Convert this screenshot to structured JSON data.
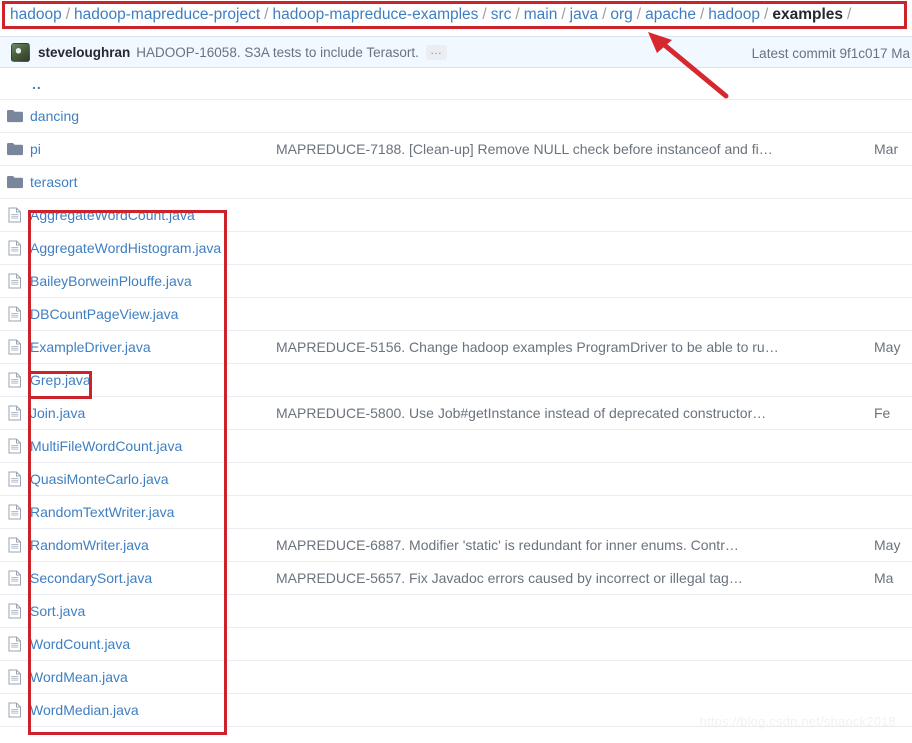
{
  "breadcrumb": {
    "separator": "/",
    "parts": [
      {
        "label": "hadoop",
        "current": false
      },
      {
        "label": "hadoop-mapreduce-project",
        "current": false
      },
      {
        "label": "hadoop-mapreduce-examples",
        "current": false
      },
      {
        "label": "src",
        "current": false
      },
      {
        "label": "main",
        "current": false
      },
      {
        "label": "java",
        "current": false
      },
      {
        "label": "org",
        "current": false
      },
      {
        "label": "apache",
        "current": false
      },
      {
        "label": "hadoop",
        "current": false
      },
      {
        "label": "examples",
        "current": true
      }
    ],
    "trailing_separator": "/"
  },
  "commit_bar": {
    "avatar_name": "user-avatar",
    "author": "steveloughran",
    "message": "HADOOP-16058. S3A tests to include Terasort.",
    "expand_label": "…",
    "latest_commit": "Latest commit 9f1c017 Ma"
  },
  "file_table": {
    "parent_dir_label": "..",
    "rows": [
      {
        "type": "folder",
        "name": "dancing",
        "message": "",
        "age": ""
      },
      {
        "type": "folder",
        "name": "pi",
        "message": "MAPREDUCE-7188. [Clean-up] Remove NULL check before instanceof and fi…",
        "age": "Mar"
      },
      {
        "type": "folder",
        "name": "terasort",
        "message": "",
        "age": ""
      },
      {
        "type": "file",
        "name": "AggregateWordCount.java",
        "message": "",
        "age": ""
      },
      {
        "type": "file",
        "name": "AggregateWordHistogram.java",
        "message": "",
        "age": ""
      },
      {
        "type": "file",
        "name": "BaileyBorweinPlouffe.java",
        "message": "",
        "age": ""
      },
      {
        "type": "file",
        "name": "DBCountPageView.java",
        "message": "",
        "age": ""
      },
      {
        "type": "file",
        "name": "ExampleDriver.java",
        "message": "MAPREDUCE-5156. Change hadoop examples ProgramDriver to be able to ru…",
        "age": "May"
      },
      {
        "type": "file",
        "name": "Grep.java",
        "message": "",
        "age": ""
      },
      {
        "type": "file",
        "name": "Join.java",
        "message": "MAPREDUCE-5800. Use Job#getInstance instead of deprecated constructor…",
        "age": "Fe"
      },
      {
        "type": "file",
        "name": "MultiFileWordCount.java",
        "message": "",
        "age": ""
      },
      {
        "type": "file",
        "name": "QuasiMonteCarlo.java",
        "message": "",
        "age": ""
      },
      {
        "type": "file",
        "name": "RandomTextWriter.java",
        "message": "",
        "age": ""
      },
      {
        "type": "file",
        "name": "RandomWriter.java",
        "message": "MAPREDUCE-6887. Modifier 'static' is redundant for inner enums. Contr…",
        "age": "May"
      },
      {
        "type": "file",
        "name": "SecondarySort.java",
        "message": "MAPREDUCE-5657. Fix Javadoc errors caused by incorrect or illegal tag…",
        "age": "Ma"
      },
      {
        "type": "file",
        "name": "Sort.java",
        "message": "",
        "age": ""
      },
      {
        "type": "file",
        "name": "WordCount.java",
        "message": "",
        "age": ""
      },
      {
        "type": "file",
        "name": "WordMean.java",
        "message": "",
        "age": ""
      },
      {
        "type": "file",
        "name": "WordMedian.java",
        "message": "",
        "age": ""
      }
    ]
  },
  "annotations": {
    "color": "#cc2229",
    "boxes": [
      "breadcrumb-highlight",
      "file-list-highlight",
      "grep-java-highlight"
    ],
    "arrow": "points-at-examples-breadcrumb"
  },
  "watermark": "https://blog.csdn.net/shaock2018"
}
